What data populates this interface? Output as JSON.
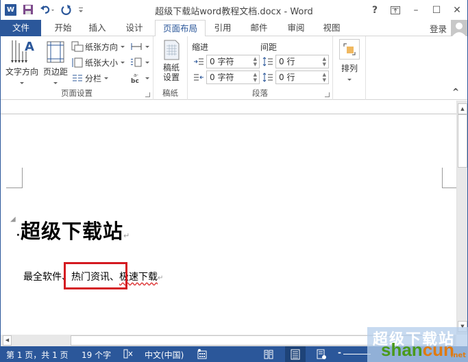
{
  "titlebar": {
    "title": "超级下载站word教程文档.docx - Word",
    "qat": {
      "app_icon": "word-logo-icon",
      "app_letter": "W",
      "save": "save-icon",
      "undo": "undo-icon",
      "redo": "redo-icon",
      "customize": "customize-qat-icon"
    },
    "controls": {
      "help": "?",
      "ribbon_display": "ribbon-display-options-icon",
      "minimize": "–",
      "maximize": "☐",
      "close": "✕"
    }
  },
  "tabs": {
    "file": "文件",
    "items": [
      "开始",
      "插入",
      "设计",
      "页面布局",
      "引用",
      "邮件",
      "审阅",
      "视图"
    ],
    "active": "页面布局",
    "login": "登录"
  },
  "ribbon": {
    "page_setup": {
      "label": "页面设置",
      "text_direction": "文字方向",
      "margins": "页边距",
      "orientation": "纸张方向",
      "size": "纸张大小",
      "columns": "分栏"
    },
    "manuscript": {
      "label": "稿纸",
      "button_line1": "稿纸",
      "button_line2": "设置"
    },
    "paragraph": {
      "label": "段落",
      "indent_label": "缩进",
      "spacing_label": "间距",
      "indent_left": "0 字符",
      "indent_right": "0 字符",
      "spacing_before": "0 行",
      "spacing_after": "0 行"
    },
    "arrange": {
      "label": "排列"
    },
    "collapse": "^"
  },
  "document": {
    "heading": "超级下载站",
    "paragraph_parts": [
      "最全软件",
      "、热门资讯、",
      "极速下载"
    ],
    "highlight_color": "#d41920",
    "return_mark": "↵"
  },
  "status": {
    "page": "第 1 页，共 1 页",
    "words": "19 个字",
    "proofing": "proofing-icon",
    "language": "中文(中国)",
    "macro": "macro-record-icon",
    "views": [
      "read-mode-icon",
      "print-layout-icon",
      "web-layout-icon"
    ],
    "active_view": "print-layout-icon",
    "zoom_out": "-"
  },
  "watermark": {
    "line1": "超级下载站",
    "line2a": "shan",
    "line2b": "cun",
    "line3": ".net"
  },
  "colors": {
    "accent": "#2b579a",
    "status_active": "#1e4378"
  }
}
